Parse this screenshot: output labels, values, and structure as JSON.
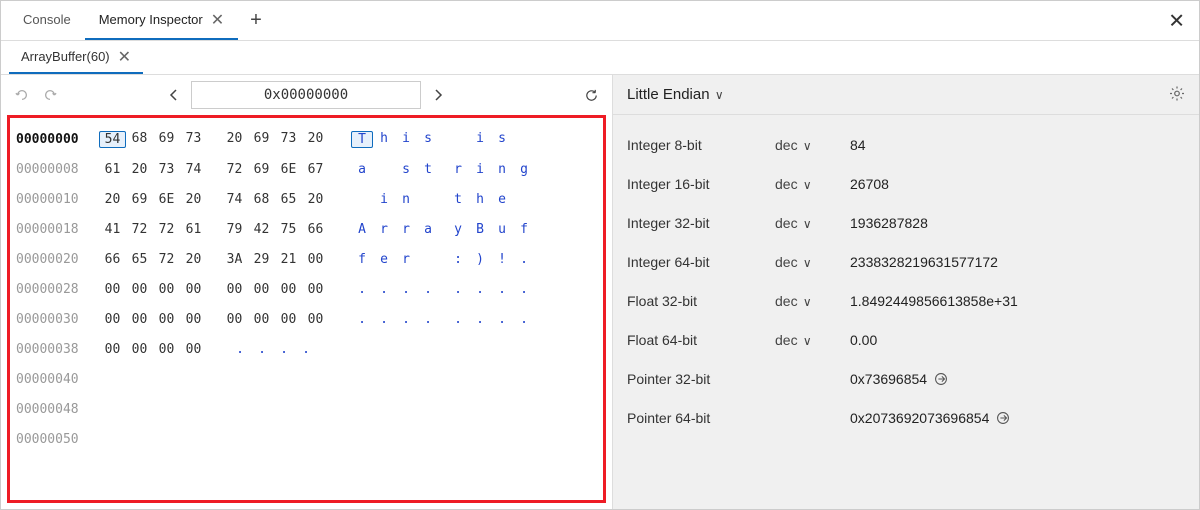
{
  "tabs": {
    "main": [
      {
        "label": "Console",
        "closable": false,
        "active": false
      },
      {
        "label": "Memory Inspector",
        "closable": true,
        "active": true
      }
    ],
    "sub": [
      {
        "label": "ArrayBuffer(60)",
        "closable": true,
        "active": true
      }
    ]
  },
  "toolbar": {
    "address_value": "0x00000000"
  },
  "hex": {
    "selected_index": 0,
    "rows": [
      {
        "addr": "00000000",
        "current": true,
        "bytes": [
          "54",
          "68",
          "69",
          "73",
          "20",
          "69",
          "73",
          "20"
        ],
        "ascii": [
          "T",
          "h",
          "i",
          "s",
          " ",
          "i",
          "s",
          " "
        ]
      },
      {
        "addr": "00000008",
        "current": false,
        "bytes": [
          "61",
          "20",
          "73",
          "74",
          "72",
          "69",
          "6E",
          "67"
        ],
        "ascii": [
          "a",
          " ",
          "s",
          "t",
          "r",
          "i",
          "n",
          "g"
        ]
      },
      {
        "addr": "00000010",
        "current": false,
        "bytes": [
          "20",
          "69",
          "6E",
          "20",
          "74",
          "68",
          "65",
          "20"
        ],
        "ascii": [
          " ",
          "i",
          "n",
          " ",
          "t",
          "h",
          "e",
          " "
        ]
      },
      {
        "addr": "00000018",
        "current": false,
        "bytes": [
          "41",
          "72",
          "72",
          "61",
          "79",
          "42",
          "75",
          "66"
        ],
        "ascii": [
          "A",
          "r",
          "r",
          "a",
          "y",
          "B",
          "u",
          "f"
        ]
      },
      {
        "addr": "00000020",
        "current": false,
        "bytes": [
          "66",
          "65",
          "72",
          "20",
          "3A",
          "29",
          "21",
          "00"
        ],
        "ascii": [
          "f",
          "e",
          "r",
          " ",
          ":",
          ")",
          "!",
          "."
        ]
      },
      {
        "addr": "00000028",
        "current": false,
        "bytes": [
          "00",
          "00",
          "00",
          "00",
          "00",
          "00",
          "00",
          "00"
        ],
        "ascii": [
          ".",
          ".",
          ".",
          ".",
          ".",
          ".",
          ".",
          "."
        ]
      },
      {
        "addr": "00000030",
        "current": false,
        "bytes": [
          "00",
          "00",
          "00",
          "00",
          "00",
          "00",
          "00",
          "00"
        ],
        "ascii": [
          ".",
          ".",
          ".",
          ".",
          ".",
          ".",
          ".",
          "."
        ]
      },
      {
        "addr": "00000038",
        "current": false,
        "bytes": [
          "00",
          "00",
          "00",
          "00"
        ],
        "ascii": [
          ".",
          ".",
          ".",
          "."
        ]
      },
      {
        "addr": "00000040",
        "current": false,
        "bytes": [],
        "ascii": []
      },
      {
        "addr": "00000048",
        "current": false,
        "bytes": [],
        "ascii": []
      },
      {
        "addr": "00000050",
        "current": false,
        "bytes": [],
        "ascii": []
      }
    ]
  },
  "inspector": {
    "endian_label": "Little Endian",
    "rows": [
      {
        "label": "Integer 8-bit",
        "fmt": "dec",
        "value": "84"
      },
      {
        "label": "Integer 16-bit",
        "fmt": "dec",
        "value": "26708"
      },
      {
        "label": "Integer 32-bit",
        "fmt": "dec",
        "value": "1936287828"
      },
      {
        "label": "Integer 64-bit",
        "fmt": "dec",
        "value": "2338328219631577172"
      },
      {
        "label": "Float 32-bit",
        "fmt": "dec",
        "value": "1.8492449856613858e+31"
      },
      {
        "label": "Float 64-bit",
        "fmt": "dec",
        "value": "0.00"
      },
      {
        "label": "Pointer 32-bit",
        "fmt": "",
        "value": "0x73696854",
        "jump": true
      },
      {
        "label": "Pointer 64-bit",
        "fmt": "",
        "value": "0x2073692073696854",
        "jump": true
      }
    ]
  }
}
